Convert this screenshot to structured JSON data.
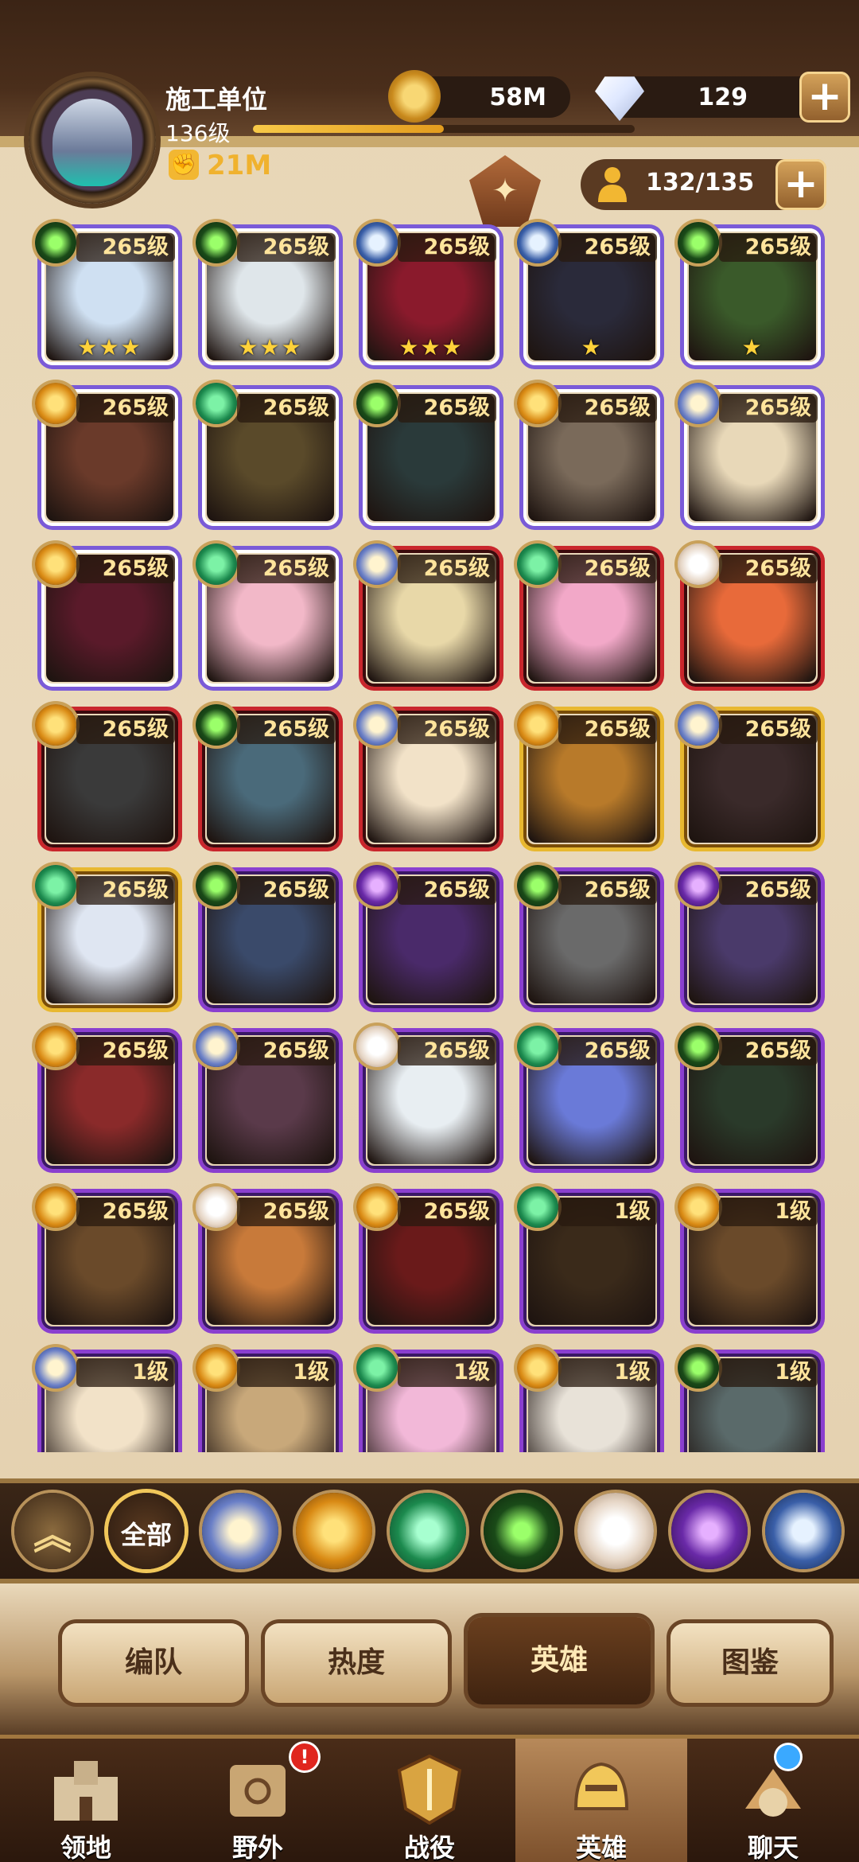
{
  "player": {
    "name": "施工单位",
    "level": "136级",
    "power": "21M",
    "xp_fraction": 0.5
  },
  "resources": {
    "gold": "58M",
    "gems": "129",
    "hero_slots": "132/135"
  },
  "heroes": [
    {
      "level": "265级",
      "faction": "e",
      "frame": "purple-white",
      "stars": "★★★"
    },
    {
      "level": "265级",
      "faction": "e",
      "frame": "purple-white",
      "stars": "★★★"
    },
    {
      "level": "265级",
      "faction": "c",
      "frame": "purple-white",
      "stars": "★★★"
    },
    {
      "level": "265级",
      "faction": "c",
      "frame": "purple-white",
      "stars": "★"
    },
    {
      "level": "265级",
      "faction": "e",
      "frame": "purple-white",
      "stars": "★"
    },
    {
      "level": "265级",
      "faction": "g",
      "frame": "purple-white",
      "stars": ""
    },
    {
      "level": "265级",
      "faction": "l",
      "frame": "purple-white",
      "stars": ""
    },
    {
      "level": "265级",
      "faction": "e",
      "frame": "purple-white",
      "stars": ""
    },
    {
      "level": "265级",
      "faction": "g",
      "frame": "purple-white",
      "stars": ""
    },
    {
      "level": "265级",
      "faction": "s",
      "frame": "purple-white",
      "stars": ""
    },
    {
      "level": "265级",
      "faction": "g",
      "frame": "purple-white",
      "stars": ""
    },
    {
      "level": "265级",
      "faction": "l",
      "frame": "purple-white",
      "stars": ""
    },
    {
      "level": "265级",
      "faction": "s",
      "frame": "red",
      "stars": ""
    },
    {
      "level": "265级",
      "faction": "l",
      "frame": "red",
      "stars": ""
    },
    {
      "level": "265级",
      "faction": "w",
      "frame": "red",
      "stars": ""
    },
    {
      "level": "265级",
      "faction": "g",
      "frame": "red",
      "stars": ""
    },
    {
      "level": "265级",
      "faction": "e",
      "frame": "red",
      "stars": ""
    },
    {
      "level": "265级",
      "faction": "s",
      "frame": "red",
      "stars": ""
    },
    {
      "level": "265级",
      "faction": "g",
      "frame": "gold",
      "stars": ""
    },
    {
      "level": "265级",
      "faction": "s",
      "frame": "gold",
      "stars": ""
    },
    {
      "level": "265级",
      "faction": "l",
      "frame": "gold",
      "stars": ""
    },
    {
      "level": "265级",
      "faction": "e",
      "frame": "purple",
      "stars": ""
    },
    {
      "level": "265级",
      "faction": "h",
      "frame": "purple",
      "stars": ""
    },
    {
      "level": "265级",
      "faction": "e",
      "frame": "purple",
      "stars": ""
    },
    {
      "level": "265级",
      "faction": "h",
      "frame": "purple",
      "stars": ""
    },
    {
      "level": "265级",
      "faction": "g",
      "frame": "purple",
      "stars": ""
    },
    {
      "level": "265级",
      "faction": "s",
      "frame": "purple",
      "stars": ""
    },
    {
      "level": "265级",
      "faction": "w",
      "frame": "purple",
      "stars": ""
    },
    {
      "level": "265级",
      "faction": "l",
      "frame": "purple",
      "stars": ""
    },
    {
      "level": "265级",
      "faction": "e",
      "frame": "purple",
      "stars": ""
    },
    {
      "level": "265级",
      "faction": "g",
      "frame": "purple",
      "stars": ""
    },
    {
      "level": "265级",
      "faction": "w",
      "frame": "purple",
      "stars": ""
    },
    {
      "level": "265级",
      "faction": "g",
      "frame": "purple",
      "stars": ""
    },
    {
      "level": "1级",
      "faction": "l",
      "frame": "purple",
      "stars": ""
    },
    {
      "level": "1级",
      "faction": "g",
      "frame": "purple",
      "stars": ""
    },
    {
      "level": "1级",
      "faction": "s",
      "frame": "purple",
      "stars": ""
    },
    {
      "level": "1级",
      "faction": "g",
      "frame": "purple",
      "stars": ""
    },
    {
      "level": "1级",
      "faction": "l",
      "frame": "purple",
      "stars": ""
    },
    {
      "level": "1级",
      "faction": "g",
      "frame": "purple",
      "stars": ""
    },
    {
      "level": "1级",
      "faction": "e",
      "frame": "purple",
      "stars": ""
    }
  ],
  "filters": {
    "up_icon": "double-chevron-up-icon",
    "all_label": "全部",
    "factions": [
      "lightbearer-icon",
      "mauler-icon",
      "wilder-icon",
      "graveborn-icon",
      "celestial-icon",
      "hypogean-icon",
      "dimensional-icon"
    ]
  },
  "tabs": [
    {
      "label": "编队",
      "active": false
    },
    {
      "label": "热度",
      "active": false
    },
    {
      "label": "英雄",
      "active": true
    },
    {
      "label": "图鉴",
      "active": false
    }
  ],
  "bottom_nav": [
    {
      "label": "领地",
      "icon": "castle-icon",
      "active": false
    },
    {
      "label": "野外",
      "icon": "map-scroll-icon",
      "active": false,
      "badge": "!"
    },
    {
      "label": "战役",
      "icon": "battle-shield-icon",
      "active": false
    },
    {
      "label": "英雄",
      "icon": "helmet-icon",
      "active": true
    },
    {
      "label": "聊天",
      "icon": "chat-hat-icon",
      "active": false,
      "dot": true
    }
  ],
  "colors": {
    "accent": "#f0b22e",
    "frame_purple": "#7a5ad8",
    "frame_red": "#c9262c",
    "frame_gold": "#e8b830"
  }
}
